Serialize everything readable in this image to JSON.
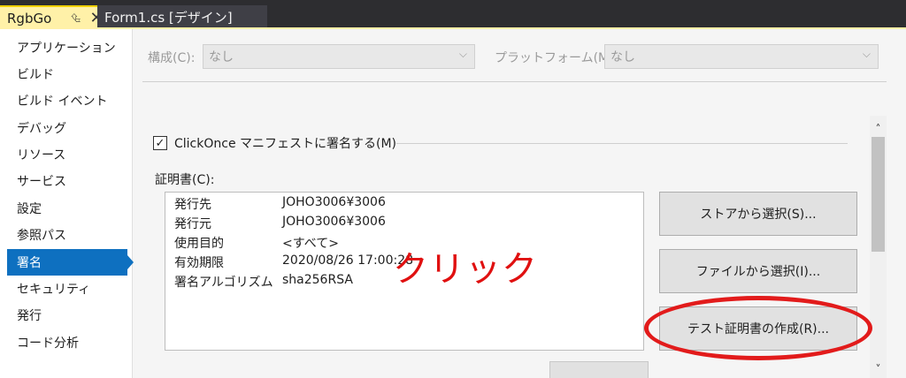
{
  "tabs": [
    {
      "label": "RgbGo",
      "active": true
    },
    {
      "label": "Form1.cs [デザイン]",
      "active": false
    }
  ],
  "sidebar": {
    "items": [
      {
        "label": "アプリケーション"
      },
      {
        "label": "ビルド"
      },
      {
        "label": "ビルド イベント"
      },
      {
        "label": "デバッグ"
      },
      {
        "label": "リソース"
      },
      {
        "label": "サービス"
      },
      {
        "label": "設定"
      },
      {
        "label": "参照パス"
      },
      {
        "label": "署名",
        "selected": true
      },
      {
        "label": "セキュリティ"
      },
      {
        "label": "発行"
      },
      {
        "label": "コード分析"
      }
    ]
  },
  "config": {
    "configuration_label": "構成(C):",
    "configuration_value": "なし",
    "platform_label": "プラットフォーム(M):",
    "platform_value": "なし"
  },
  "signing": {
    "checkbox_label": "ClickOnce マニフェストに署名する(M)",
    "checked": true,
    "certificate_label": "証明書(C):",
    "certificate_rows": [
      {
        "key": "発行先",
        "value": "JOHO3006¥3006"
      },
      {
        "key": "発行元",
        "value": "JOHO3006¥3006"
      },
      {
        "key": "使用目的",
        "value": "<すべて>"
      },
      {
        "key": "有効期限",
        "value": "2020/08/26 17:00:28"
      },
      {
        "key": "署名アルゴリズム",
        "value": "sha256RSA"
      }
    ],
    "buttons": {
      "select_from_store": "ストアから選択(S)...",
      "select_from_file": "ファイルから選択(I)...",
      "create_test_cert": "テスト証明書の作成(R)..."
    }
  },
  "annotation": {
    "text": "クリック",
    "color": "#e21b1b"
  },
  "colors": {
    "selected_bg": "#0e70c0",
    "active_tab_bg": "#fff1a8",
    "tabbar_bg": "#2d2d30"
  }
}
